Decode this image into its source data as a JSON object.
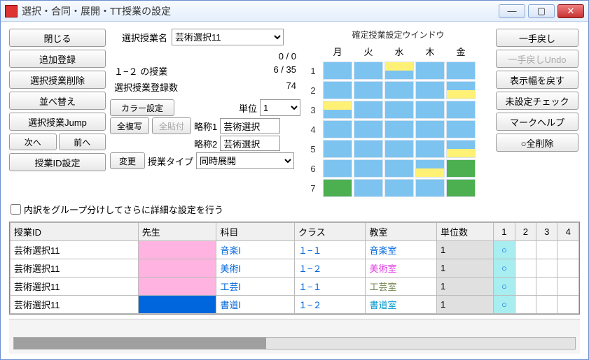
{
  "window": {
    "title": "選択・合同・展開・TT授業の設定"
  },
  "buttons": {
    "close": "閉じる",
    "add": "追加登録",
    "delete": "選択授業削除",
    "sort": "並べ替え",
    "jump": "選択授業Jump",
    "next": "次へ",
    "prev": "前へ",
    "colorset": "カラー設定",
    "allcopy": "全複写",
    "allpaste": "全貼付",
    "idset": "授業ID設定",
    "change": "変更",
    "undo": "一手戻し",
    "undo2": "一手戻しUndo",
    "resetw": "表示幅を戻す",
    "checku": "未設定チェック",
    "markhelp": "マークヘルプ",
    "delall": "○全削除"
  },
  "labels": {
    "selname": "選択授業名",
    "unit": "単位",
    "abbr1": "略称1",
    "abbr2": "略称2",
    "classtype": "授業タイプ",
    "gridtitle": "確定授業設定ウインドウ",
    "checkbox": "内訳をグループ分けしてさらに詳細な設定を行う",
    "stat1l": "",
    "stat1r": "0 / 0",
    "stat2l": "１−２ の授業",
    "stat2r": "6 / 35",
    "stat3l": "選択授業登録数",
    "stat3r": "74"
  },
  "values": {
    "selname": "芸術選択11",
    "unit": "1",
    "abbr1": "芸術選択",
    "abbr2": "芸術選択",
    "classtype": "同時展開"
  },
  "schedule": {
    "days": [
      "月",
      "火",
      "水",
      "木",
      "金"
    ],
    "periods": [
      1,
      2,
      3,
      4,
      5,
      6,
      7
    ],
    "cells": [
      [
        "blue",
        "blue",
        "yb",
        "blue",
        "blue"
      ],
      [
        "blue",
        "blue",
        "blue",
        "blue",
        "by"
      ],
      [
        "yb",
        "blue",
        "blue",
        "blue",
        "blue"
      ],
      [
        "blue",
        "blue",
        "blue",
        "blue",
        "blue"
      ],
      [
        "blue",
        "blue",
        "blue",
        "blue",
        "by"
      ],
      [
        "blue",
        "blue",
        "blue",
        "by",
        "green"
      ],
      [
        "green",
        "blue",
        "blue",
        "blue",
        "green"
      ]
    ]
  },
  "table": {
    "headers": [
      "授業ID",
      "先生",
      "科目",
      "クラス",
      "教室",
      "単位数",
      "1",
      "2",
      "3",
      "4"
    ],
    "rows": [
      {
        "id": "芸術選択11",
        "teacher": "",
        "tclr": "pink",
        "subj": "音楽Ⅰ",
        "cls": "１−１",
        "room": "音楽室",
        "rclr": "blue",
        "units": "1"
      },
      {
        "id": "芸術選択11",
        "teacher": "",
        "tclr": "pink",
        "subj": "美術Ⅰ",
        "cls": "１−２",
        "room": "美術室",
        "rclr": "mag",
        "units": "1"
      },
      {
        "id": "芸術選択11",
        "teacher": "",
        "tclr": "pink",
        "subj": "工芸Ⅰ",
        "cls": "１−１",
        "room": "工芸室",
        "rclr": "olive",
        "units": "1"
      },
      {
        "id": "芸術選択11",
        "teacher": "",
        "tclr": "blue",
        "subj": "書道Ⅰ",
        "cls": "１−２",
        "room": "書道室",
        "rclr": "teal",
        "units": "1"
      }
    ]
  }
}
